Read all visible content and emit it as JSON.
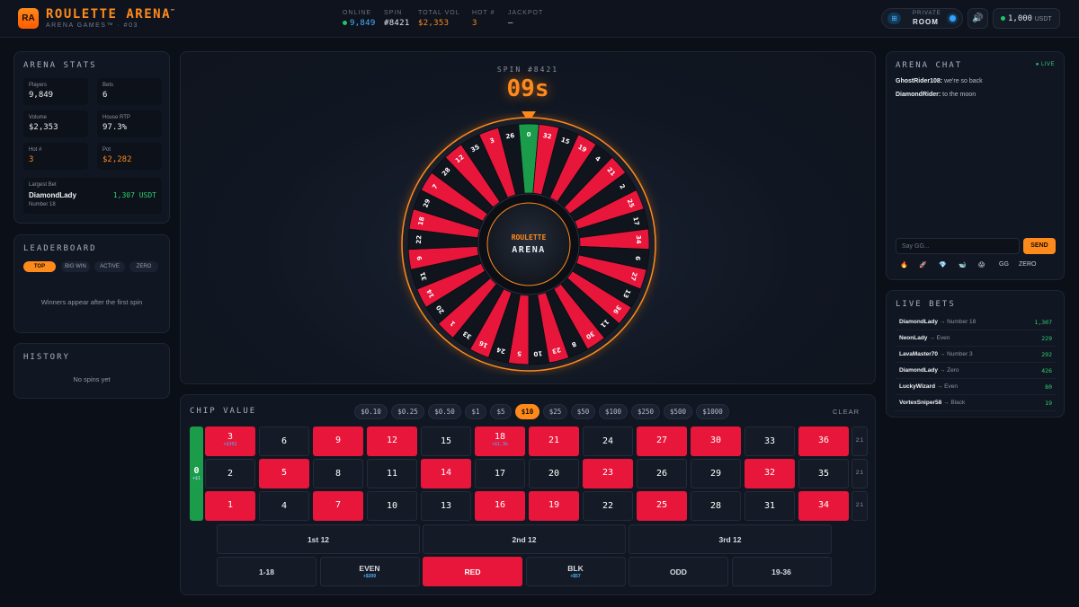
{
  "header": {
    "logo_badge": "RA",
    "title": "ROULETTE ARENA",
    "title_mark": "™",
    "subtitle": "ARENA GAMES™ · #03",
    "stats": [
      {
        "label": "ONLINE",
        "value": "9,849",
        "color": "#4ab2ff"
      },
      {
        "label": "SPIN",
        "value": "#8421",
        "color": "#e6e9ef"
      },
      {
        "label": "TOTAL VOL",
        "value": "$2,353",
        "color": "#ff8a1c"
      },
      {
        "label": "HOT #",
        "value": "3",
        "color": "#ff8a1c"
      },
      {
        "label": "JACKPOT",
        "value": "–",
        "color": "#e6e9ef"
      }
    ],
    "private_room_top": "PRIVATE",
    "private_room_bottom": "ROOM",
    "sound_icon": "🔊",
    "balance_value": "1,000",
    "balance_unit": "USDT"
  },
  "arena_stats": {
    "title": "ARENA STATS",
    "cards": [
      {
        "label": "Players",
        "value": "9,849"
      },
      {
        "label": "Bets",
        "value": "6"
      },
      {
        "label": "Volume",
        "value": "$2,353"
      },
      {
        "label": "House RTP",
        "value": "97.3%"
      },
      {
        "label": "Hot #",
        "value": "3"
      },
      {
        "label": "Pot",
        "value": "$2,282"
      }
    ],
    "largest_label": "Largest Bet",
    "largest_name": "DiamondLady",
    "largest_sub": "Number 18",
    "largest_amount": "1,307 USDT"
  },
  "leaderboard": {
    "title": "LEADERBOARD",
    "tabs": [
      "TOP",
      "BIG WIN",
      "ACTIVE",
      "ZERO"
    ],
    "empty": "Winners appear after the first spin"
  },
  "history": {
    "title": "HISTORY",
    "empty": "No spins yet"
  },
  "wheel": {
    "spin_label": "SPIN #8421",
    "countdown": "09s",
    "center_top": "ROULETTE",
    "center_bottom": "ARENA",
    "numbers": [
      0,
      32,
      15,
      19,
      4,
      21,
      2,
      25,
      17,
      34,
      6,
      27,
      13,
      36,
      11,
      30,
      8,
      23,
      10,
      5,
      24,
      16,
      33,
      1,
      20,
      14,
      31,
      9,
      22,
      18,
      29,
      7,
      28,
      12,
      35,
      3,
      26
    ],
    "red_numbers": [
      1,
      3,
      5,
      7,
      9,
      12,
      14,
      16,
      18,
      19,
      21,
      23,
      25,
      27,
      30,
      32,
      34,
      36
    ],
    "colors": {
      "red": "#e8163a",
      "black": "#10141c",
      "green": "#1b9c4a",
      "accent": "#ff8a1c"
    }
  },
  "betting": {
    "chip_label": "CHIP VALUE",
    "chips": [
      "$0.10",
      "$0.25",
      "$0.50",
      "$1",
      "$5",
      "$10",
      "$25",
      "$50",
      "$100",
      "$250",
      "$500",
      "$1000"
    ],
    "active_chip": "$10",
    "clear": "CLEAR",
    "zero": {
      "label": "0",
      "bet": "+$1"
    },
    "rows": [
      [
        {
          "n": "3",
          "c": "red",
          "bet": "+$302"
        },
        {
          "n": "6",
          "c": "black"
        },
        {
          "n": "9",
          "c": "red"
        },
        {
          "n": "12",
          "c": "red"
        },
        {
          "n": "15",
          "c": "black"
        },
        {
          "n": "18",
          "c": "red",
          "bet": "+$1.3k"
        },
        {
          "n": "21",
          "c": "red"
        },
        {
          "n": "24",
          "c": "black"
        },
        {
          "n": "27",
          "c": "red"
        },
        {
          "n": "30",
          "c": "red"
        },
        {
          "n": "33",
          "c": "black"
        },
        {
          "n": "36",
          "c": "red"
        }
      ],
      [
        {
          "n": "2",
          "c": "black"
        },
        {
          "n": "5",
          "c": "red"
        },
        {
          "n": "8",
          "c": "black"
        },
        {
          "n": "11",
          "c": "black"
        },
        {
          "n": "14",
          "c": "red"
        },
        {
          "n": "17",
          "c": "black"
        },
        {
          "n": "20",
          "c": "black"
        },
        {
          "n": "23",
          "c": "red"
        },
        {
          "n": "26",
          "c": "black"
        },
        {
          "n": "29",
          "c": "black"
        },
        {
          "n": "32",
          "c": "red"
        },
        {
          "n": "35",
          "c": "black"
        }
      ],
      [
        {
          "n": "1",
          "c": "red"
        },
        {
          "n": "4",
          "c": "black"
        },
        {
          "n": "7",
          "c": "red"
        },
        {
          "n": "10",
          "c": "black"
        },
        {
          "n": "13",
          "c": "black"
        },
        {
          "n": "16",
          "c": "red"
        },
        {
          "n": "19",
          "c": "red"
        },
        {
          "n": "22",
          "c": "black"
        },
        {
          "n": "25",
          "c": "red"
        },
        {
          "n": "28",
          "c": "black"
        },
        {
          "n": "31",
          "c": "black"
        },
        {
          "n": "34",
          "c": "red"
        }
      ]
    ],
    "column_bet": "2:1",
    "dozens": [
      "1st 12",
      "2nd 12",
      "3rd 12"
    ],
    "outside": [
      {
        "label": "1-18"
      },
      {
        "label": "EVEN",
        "bet": "+$309"
      },
      {
        "label": "RED",
        "red": true
      },
      {
        "label": "BLK",
        "bet": "+$57"
      },
      {
        "label": "ODD"
      },
      {
        "label": "19-36"
      }
    ]
  },
  "chat": {
    "title": "ARENA CHAT",
    "live": "LIVE",
    "messages": [
      {
        "user": "GhostRider108:",
        "text": "we're so back"
      },
      {
        "user": "DiamondRider:",
        "text": "to the moon"
      }
    ],
    "placeholder": "Say GG...",
    "send": "SEND",
    "quick": [
      "🔥",
      "🚀",
      "💎",
      "🐋",
      "😱",
      "GG",
      "ZERO"
    ]
  },
  "live_bets": {
    "title": "LIVE BETS",
    "rows": [
      {
        "user": "DiamondLady",
        "bet": "Number 18",
        "amount": "1,307"
      },
      {
        "user": "NeonLady",
        "bet": "Even",
        "amount": "229"
      },
      {
        "user": "LavaMaster70",
        "bet": "Number 3",
        "amount": "292"
      },
      {
        "user": "DiamondLady",
        "bet": "Zero",
        "amount": "426"
      },
      {
        "user": "LuckyWizard",
        "bet": "Even",
        "amount": "80"
      },
      {
        "user": "VortexSniper58",
        "bet": "Black",
        "amount": "19"
      }
    ]
  }
}
